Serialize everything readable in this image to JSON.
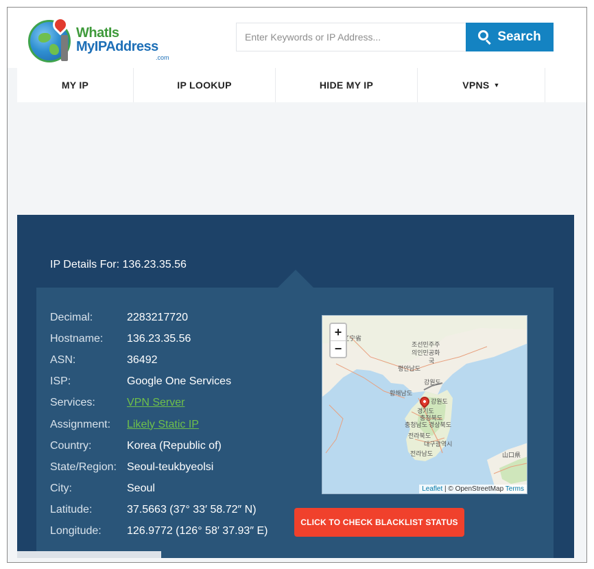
{
  "header": {
    "logo": {
      "line1": "WhatIs",
      "line2": "MyIPAddress",
      "suffix": ".com"
    },
    "search": {
      "placeholder": "Enter Keywords or IP Address...",
      "button_label": "Search"
    }
  },
  "nav": {
    "items": [
      {
        "label": "MY IP"
      },
      {
        "label": "IP LOOKUP"
      },
      {
        "label": "HIDE MY IP"
      },
      {
        "label": "VPNS",
        "caret": "▼"
      }
    ]
  },
  "details": {
    "title": "IP Details For: 136.23.35.56",
    "rows": [
      {
        "label": "Decimal:",
        "value": "2283217720"
      },
      {
        "label": "Hostname:",
        "value": "136.23.35.56"
      },
      {
        "label": "ASN:",
        "value": "36492"
      },
      {
        "label": "ISP:",
        "value": "Google One Services"
      },
      {
        "label": "Services:",
        "value": "VPN Server"
      },
      {
        "label": "Assignment:",
        "value": "Likely Static IP"
      },
      {
        "label": "Country:",
        "value": "Korea (Republic of)"
      },
      {
        "label": "State/Region:",
        "value": "Seoul-teukbyeolsi"
      },
      {
        "label": "City:",
        "value": "Seoul"
      },
      {
        "label": "Latitude:",
        "value": "37.5663 (37° 33′ 58.72″ N)"
      },
      {
        "label": "Longitude:",
        "value": "126.9772 (126° 58′ 37.93″ E)"
      }
    ]
  },
  "map": {
    "zoom_in": "+",
    "zoom_out": "−",
    "attribution": {
      "leaflet": "Leaflet",
      "sep": " | © OpenStreetMap ",
      "terms": "Terms"
    },
    "labels": {
      "china": "辽宁省",
      "nk1": "조선민주주",
      "nk2": "의인민공화",
      "nk3": "국",
      "pyongan": "평안남도",
      "gangwon_n": "강원도",
      "hwanghae": "황해남도",
      "gangwon_s": "강원도",
      "gyeonggi": "경기도",
      "chungbuk": "충청북도",
      "chungnam": "충청남도",
      "gyeongbuk": "경상북도",
      "jeonbuk": "전라북도",
      "daegu": "대구광역시",
      "jeonnam": "전라남도",
      "japan": "山口県"
    }
  },
  "blacklist_button": "CLICK TO CHECK BLACKLIST STATUS"
}
